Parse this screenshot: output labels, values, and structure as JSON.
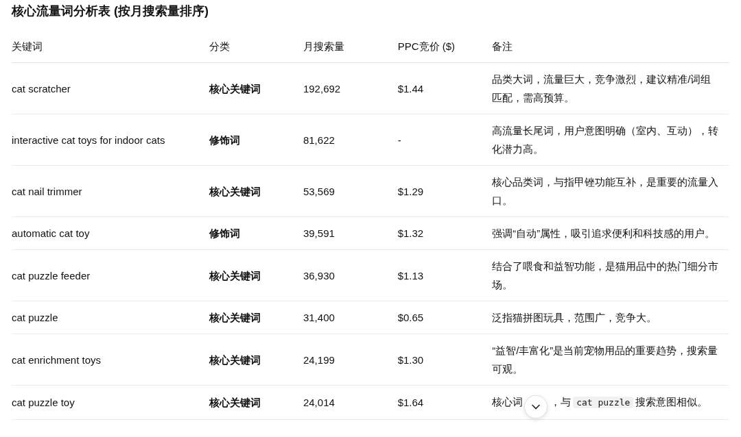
{
  "title": "核心流量词分析表 (按月搜索量排序)",
  "columns": [
    "关键词",
    "分类",
    "月搜索量",
    "PPC竞价 ($)",
    "备注"
  ],
  "rows": [
    {
      "keyword": "cat scratcher",
      "category": "核心关键词",
      "volume": "192,692",
      "ppc": "$1.44",
      "note": [
        {
          "kind": "text",
          "text": "品类大词，流量巨大，竞争激烈，建议精准/词组匹配，需高预算。"
        }
      ]
    },
    {
      "keyword": "interactive cat toys for indoor cats",
      "category": "修饰词",
      "volume": "81,622",
      "ppc": "-",
      "note": [
        {
          "kind": "text",
          "text": "高流量长尾词，用户意图明确（室内、互动），转化潜力高。"
        }
      ]
    },
    {
      "keyword": "cat nail trimmer",
      "category": "核心关键词",
      "volume": "53,569",
      "ppc": "$1.29",
      "note": [
        {
          "kind": "text",
          "text": "核心品类词，与指甲锉功能互补，是重要的流量入口。"
        }
      ]
    },
    {
      "keyword": "automatic cat toy",
      "category": "修饰词",
      "volume": "39,591",
      "ppc": "$1.32",
      "note": [
        {
          "kind": "text",
          "text": "强调“自动”属性，吸引追求便利和科技感的用户。"
        }
      ]
    },
    {
      "keyword": "cat puzzle feeder",
      "category": "核心关键词",
      "volume": "36,930",
      "ppc": "$1.13",
      "note": [
        {
          "kind": "text",
          "text": "结合了喂食和益智功能，是猫用品中的热门细分市场。"
        }
      ]
    },
    {
      "keyword": "cat puzzle",
      "category": "核心关键词",
      "volume": "31,400",
      "ppc": "$0.65",
      "note": [
        {
          "kind": "text",
          "text": "泛指猫拼图玩具，范围广，竞争大。"
        }
      ]
    },
    {
      "keyword": "cat enrichment toys",
      "category": "核心关键词",
      "volume": "24,199",
      "ppc": "$1.30",
      "note": [
        {
          "kind": "text",
          "text": "“益智/丰富化”是当前宠物用品的重要趋势，搜索量可观。"
        }
      ]
    },
    {
      "keyword": "cat puzzle toy",
      "category": "核心关键词",
      "volume": "24,014",
      "ppc": "$1.64",
      "note": [
        {
          "kind": "text",
          "text": "核心词"
        },
        {
          "kind": "gap"
        },
        {
          "kind": "text",
          "text": "，与"
        },
        {
          "kind": "code",
          "text": "cat puzzle"
        },
        {
          "kind": "text",
          "text": "搜索意图相似。"
        }
      ]
    }
  ]
}
